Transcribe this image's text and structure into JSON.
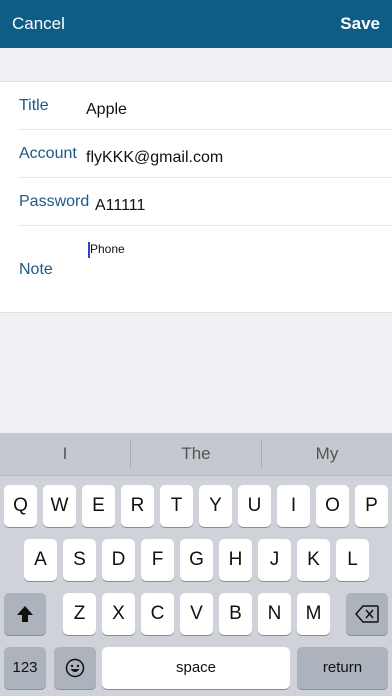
{
  "nav": {
    "cancel_label": "Cancel",
    "save_label": "Save"
  },
  "form": {
    "title_label": "Title",
    "title_value": "Apple",
    "account_label": "Account",
    "account_value": "flyKKK@gmail.com",
    "password_label": "Password",
    "password_value": "A11111",
    "note_label": "Note",
    "note_value": "Phone"
  },
  "keyboard": {
    "suggestions": [
      "I",
      "The",
      "My"
    ],
    "row1": [
      "Q",
      "W",
      "E",
      "R",
      "T",
      "Y",
      "U",
      "I",
      "O",
      "P"
    ],
    "row2": [
      "A",
      "S",
      "D",
      "F",
      "G",
      "H",
      "J",
      "K",
      "L"
    ],
    "row3": [
      "Z",
      "X",
      "C",
      "V",
      "B",
      "N",
      "M"
    ],
    "numbers_label": "123",
    "space_label": "space",
    "return_label": "return",
    "shift_icon": "shift-icon",
    "delete_icon": "backspace-icon",
    "emoji_icon": "emoji-icon"
  }
}
